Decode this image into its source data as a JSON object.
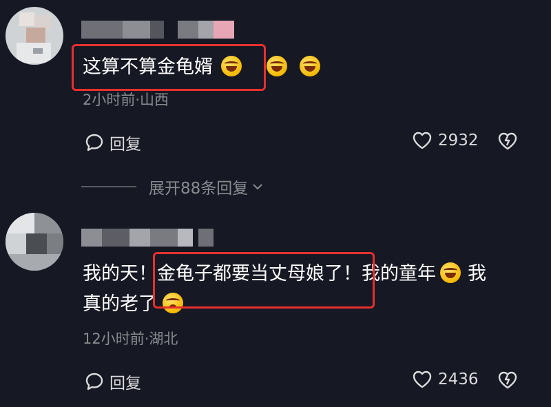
{
  "comments": [
    {
      "text": "这算不算金龟婿",
      "meta": "2小时前·山西",
      "reply_label": "回复",
      "likes": "2932"
    },
    {
      "text_line1": "我的天！金龟子都要当丈母娘了！我的童年",
      "text_line1_tail": "我",
      "text_line2": "真的老了",
      "meta": "12小时前·湖北",
      "reply_label": "回复",
      "likes": "2436"
    }
  ],
  "expand_replies": "展开88条回复",
  "colors": {
    "background": "#161823",
    "highlight_box": "#e8302e",
    "meta_text": "#8a8b91"
  }
}
